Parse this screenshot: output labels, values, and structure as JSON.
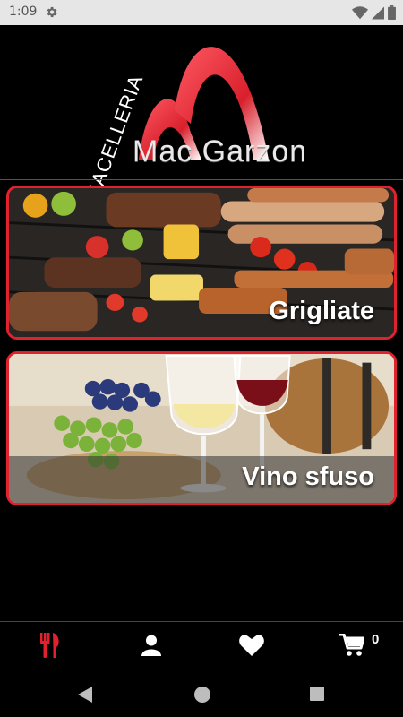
{
  "status_bar": {
    "time": "1:09"
  },
  "logo": {
    "side_text": "MACELLERIA",
    "main_text": "Mac Garzon"
  },
  "categories": [
    {
      "label": "Grigliate"
    },
    {
      "label": "Vino sfuso"
    }
  ],
  "tab_bar": {
    "cart_count": "0"
  },
  "colors": {
    "accent": "#e0222e",
    "background": "#000000",
    "status_bar": "#e6e6e6"
  },
  "icons": [
    "gear-icon",
    "wifi-icon",
    "signal-icon",
    "battery-icon",
    "fork-knife-icon",
    "user-icon",
    "heart-icon",
    "cart-icon",
    "back-icon",
    "home-icon",
    "recents-icon"
  ]
}
